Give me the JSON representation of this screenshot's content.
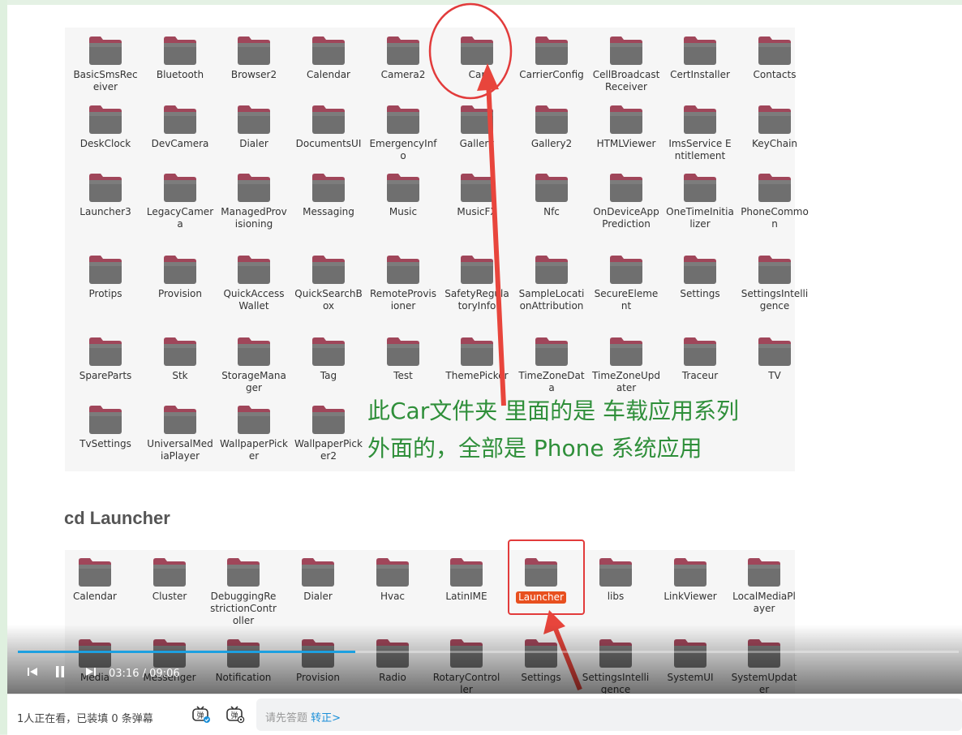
{
  "grid1": {
    "rows": [
      [
        "BasicSmsReceiver",
        "Bluetooth",
        "Browser2",
        "Calendar",
        "Camera2",
        "Car",
        "CarrierConfig",
        "CellBroadcastReceiver",
        "CertInstaller",
        "Contacts"
      ],
      [
        "DeskClock",
        "DevCamera",
        "Dialer",
        "DocumentsUI",
        "EmergencyInfo",
        "Gallery",
        "Gallery2",
        "HTMLViewer",
        "ImsService Entitlement",
        "KeyChain"
      ],
      [
        "Launcher3",
        "LegacyCamera",
        "ManagedProvisioning",
        "Messaging",
        "Music",
        "MusicFX",
        "Nfc",
        "OnDeviceAppPrediction",
        "OneTimeInitializer",
        "PhoneCommon"
      ],
      [
        "Protips",
        "Provision",
        "QuickAccessWallet",
        "QuickSearchBox",
        "RemoteProvisioner",
        "SafetyRegulatoryInfo",
        "SampleLocationAttribution",
        "SecureElement",
        "Settings",
        "SettingsIntelligence"
      ],
      [
        "SpareParts",
        "Stk",
        "StorageManager",
        "Tag",
        "Test",
        "ThemePicker",
        "TimeZoneData",
        "TimeZoneUpdater",
        "Traceur",
        "TV"
      ],
      [
        "TvSettings",
        "UniversalMediaPlayer",
        "WallpaperPicker",
        "WallpaperPicker2"
      ]
    ]
  },
  "cd_heading": "cd Launcher",
  "annotation": {
    "line1": "此Car文件夹 里面的是 车载应用系列",
    "line2": "外面的，全部是 Phone 系统应用"
  },
  "grid2": {
    "row1": [
      "Calendar",
      "Cluster",
      "DebuggingRestrictionController",
      "Dialer",
      "Hvac",
      "LatinIME",
      "Launcher",
      "libs",
      "LinkViewer",
      "LocalMediaPlayer"
    ],
    "row2": [
      "Media",
      "Messenger",
      "Notification",
      "Provision",
      "Radio",
      "RotaryController",
      "Settings",
      "SettingsIntelligence",
      "SystemUI",
      "SystemUpdater"
    ],
    "highlighted": "Launcher"
  },
  "player": {
    "current_time": "03:16",
    "separator": "/",
    "duration": "09:06",
    "progress": 0.359
  },
  "bottom_bar": {
    "viewer_text": "1人正在看，已装填 0 条弹幕",
    "comment_placeholder": "请先答题",
    "comment_link": "转正>"
  },
  "colors": {
    "folder_body": "#6f6f6f",
    "folder_tab": "#a0465a",
    "annotation": "#2f8f3a",
    "highlight_box": "#e23b3b",
    "progress": "#1da0e0",
    "link": "#1a8fd8"
  },
  "icons": {
    "folder": "folder-icon",
    "prev": "skip-previous-icon",
    "pause": "pause-icon",
    "next": "skip-next-icon",
    "danmaku_toggle": "danmaku-toggle-icon",
    "danmaku_settings": "danmaku-settings-icon"
  }
}
